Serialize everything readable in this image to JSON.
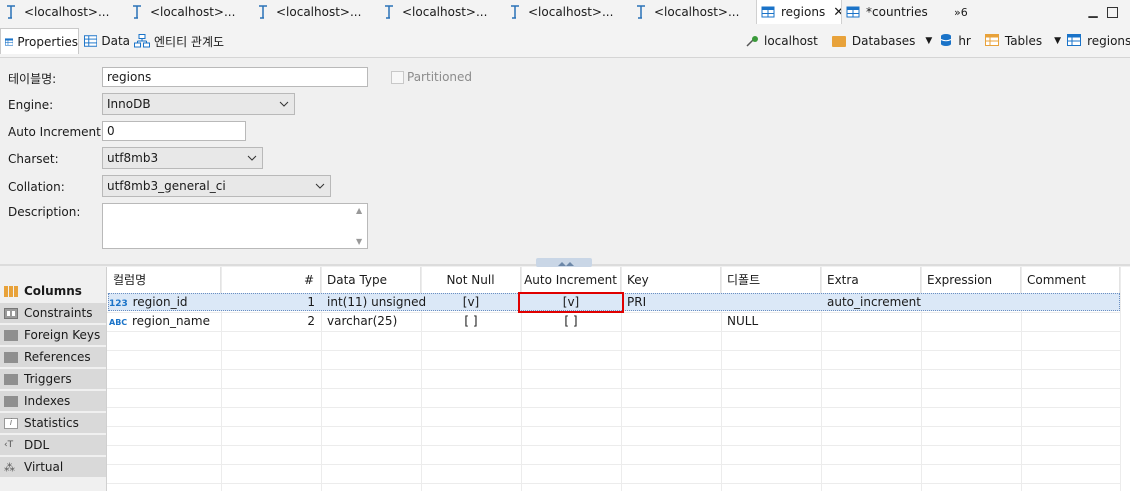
{
  "editor_tabs": [
    {
      "label": "<localhost>..."
    },
    {
      "label": "<localhost>..."
    },
    {
      "label": "<localhost>..."
    },
    {
      "label": "<localhost>..."
    },
    {
      "label": "<localhost>..."
    },
    {
      "label": "<localhost>..."
    },
    {
      "label": "regions",
      "active": true
    },
    {
      "label": "*countries"
    },
    {
      "label": "»6"
    }
  ],
  "sub_tabs": {
    "properties": "Properties",
    "data": "Data",
    "er": "엔티티 관계도"
  },
  "breadcrumb": {
    "connection": "localhost",
    "databases": "Databases",
    "schema": "hr",
    "tables": "Tables",
    "table": "regions"
  },
  "form": {
    "table_name_label": "테이블명:",
    "table_name_value": "regions",
    "partitioned_label": "Partitioned",
    "engine_label": "Engine:",
    "engine_value": "InnoDB",
    "auto_increment_label": "Auto Increment:",
    "auto_increment_value": "0",
    "charset_label": "Charset:",
    "charset_value": "utf8mb3",
    "collation_label": "Collation:",
    "collation_value": "utf8mb3_general_ci",
    "description_label": "Description:",
    "description_value": ""
  },
  "nav": [
    {
      "label": "Columns",
      "active": true
    },
    {
      "label": "Constraints"
    },
    {
      "label": "Foreign Keys"
    },
    {
      "label": "References"
    },
    {
      "label": "Triggers"
    },
    {
      "label": "Indexes"
    },
    {
      "label": "Statistics"
    },
    {
      "label": "DDL"
    },
    {
      "label": "Virtual"
    }
  ],
  "columns_table": {
    "headers": [
      "컬럼명",
      "#",
      "Data Type",
      "Not Null",
      "Auto Increment",
      "Key",
      "디폴트",
      "Extra",
      "Expression",
      "Comment"
    ],
    "rows": [
      {
        "name": "region_id",
        "num": "1",
        "type": "int(11) unsigned",
        "not_null": "[v]",
        "auto_inc": "[v]",
        "key": "PRI",
        "default": "",
        "extra": "auto_increment",
        "expression": "",
        "comment": "",
        "icon": "123"
      },
      {
        "name": "region_name",
        "num": "2",
        "type": "varchar(25)",
        "not_null": "[ ]",
        "auto_inc": "[ ]",
        "key": "",
        "default": "NULL",
        "extra": "",
        "expression": "",
        "comment": "",
        "icon": "ABC"
      }
    ]
  },
  "colors": {
    "selection_row": "#dbe8f7",
    "highlight_box": "#e00000",
    "active_tab_icon": "#1a73c8"
  }
}
